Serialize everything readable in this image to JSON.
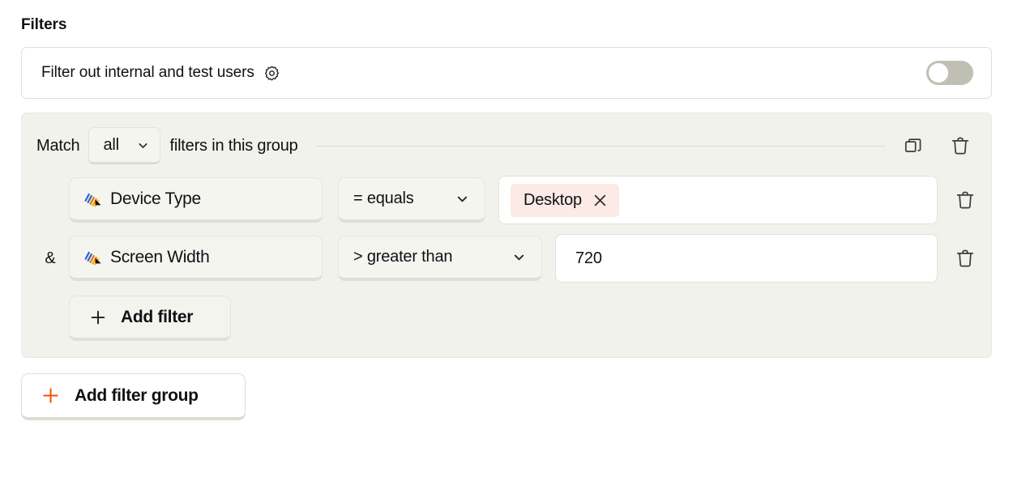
{
  "page_title": "Filters",
  "internal_filter": {
    "label": "Filter out internal and test users",
    "settings_icon": "gear-icon",
    "toggle_state": "off"
  },
  "group": {
    "match_prefix": "Match",
    "match_value": "all",
    "match_suffix": "filters in this group",
    "duplicate_icon": "duplicate-icon",
    "delete_icon": "trash-icon",
    "filters": [
      {
        "conjunction": "",
        "property": "Device Type",
        "property_icon": "property-type-string-icon",
        "operator": "= equals",
        "operator_symbol": "=",
        "value_pill": "Desktop",
        "remove_value_icon": "close-icon",
        "delete_icon": "trash-icon"
      },
      {
        "conjunction": "&",
        "property": "Screen Width",
        "property_icon": "property-type-string-icon",
        "operator": "> greater than",
        "operator_symbol": ">",
        "value": "720",
        "delete_icon": "trash-icon"
      }
    ],
    "add_filter_label": "Add filter",
    "add_filter_icon": "plus-icon"
  },
  "add_filter_group": {
    "label": "Add filter group",
    "icon": "plus-icon"
  },
  "colors": {
    "accent": "#f54e00",
    "group_background": "#f2f2ec",
    "value_pill_background": "#fbeae5",
    "toggle_off_track": "#bfbfb4",
    "text": "#111014"
  }
}
